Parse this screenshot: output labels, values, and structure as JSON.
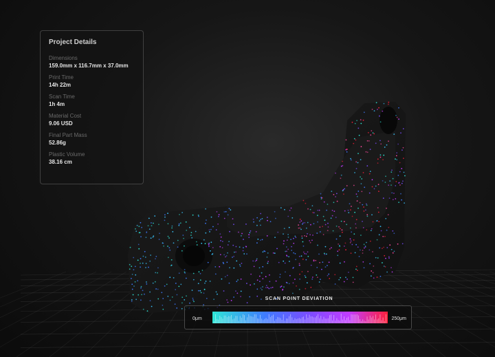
{
  "panel": {
    "title": "Project Details",
    "stats": [
      {
        "label": "Dimensions",
        "value": "159.0mm x 116.7mm x 37.0mm"
      },
      {
        "label": "Print Time",
        "value": "14h 22m"
      },
      {
        "label": "Scan Time",
        "value": "1h 4m"
      },
      {
        "label": "Material Cost",
        "value": "9.06 USD"
      },
      {
        "label": "Final Part Mass",
        "value": "52.86g"
      },
      {
        "label": "Plastic Volume",
        "value": "38.16 cm"
      }
    ]
  },
  "deviation": {
    "title": "SCAN POINT DEVIATION",
    "min_label": "0μm",
    "max_label": "250μm",
    "gradient_colors": [
      "#2ee6d6",
      "#3f7bff",
      "#7a4cff",
      "#c23cff",
      "#ff1f3a"
    ]
  },
  "icons": {
    "background": "3d-part-scan"
  }
}
